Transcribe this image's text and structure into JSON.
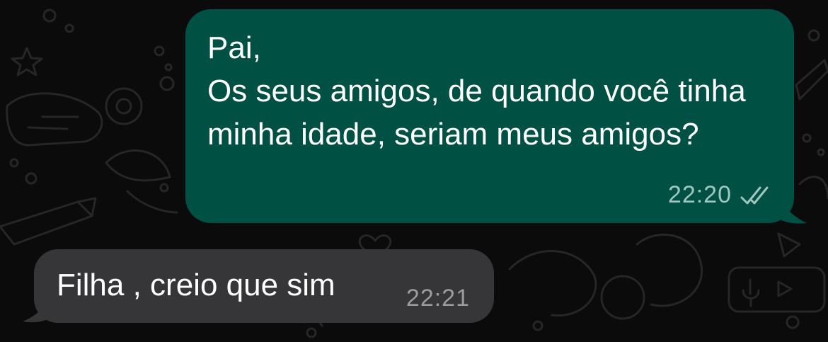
{
  "chat": {
    "messages": [
      {
        "direction": "outgoing",
        "text": "Pai,\nOs seus amigos, de quando você tinha minha idade, seriam meus amigos?",
        "time": "22:20",
        "status_icon": "double-check-icon"
      },
      {
        "direction": "incoming",
        "text": "Filha , creio que sim",
        "time": "22:21"
      }
    ]
  },
  "colors": {
    "background": "#0b0b0b",
    "outgoing_bubble": "#005144",
    "incoming_bubble": "#363638",
    "doodle": "#2a2a2a"
  }
}
